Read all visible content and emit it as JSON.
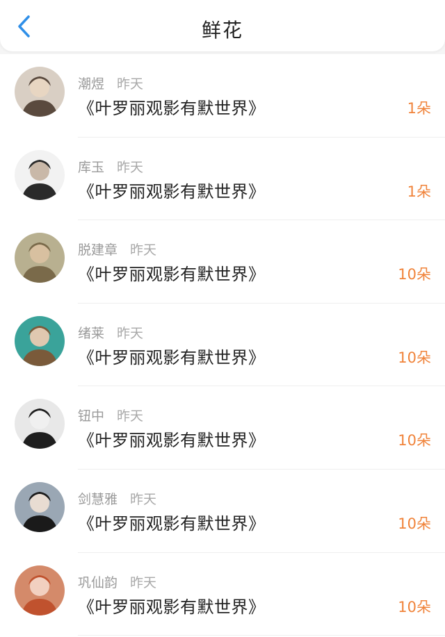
{
  "header": {
    "title": "鲜花",
    "back_icon": "chevron-left-icon",
    "accent": "#2f8fe8"
  },
  "colors": {
    "count": "#f0833a",
    "meta": "#9a9a9a"
  },
  "items": [
    {
      "name": "潮煜",
      "time": "昨天",
      "book": "《叶罗丽观影有默世界》",
      "count": "1朵",
      "avatar_palette": [
        "#d9cfc4",
        "#5a4a3e",
        "#e8d6c2"
      ]
    },
    {
      "name": "库玉",
      "time": "昨天",
      "book": "《叶罗丽观影有默世界》",
      "count": "1朵",
      "avatar_palette": [
        "#f2f2f2",
        "#2a2a2a",
        "#c9b8a8"
      ]
    },
    {
      "name": "脱建章",
      "time": "昨天",
      "book": "《叶罗丽观影有默世界》",
      "count": "10朵",
      "avatar_palette": [
        "#b8b090",
        "#7a6a4a",
        "#d8c0a0"
      ]
    },
    {
      "name": "绪莱",
      "time": "昨天",
      "book": "《叶罗丽观影有默世界》",
      "count": "10朵",
      "avatar_palette": [
        "#3aa39a",
        "#7a5a3a",
        "#e0c8b0"
      ]
    },
    {
      "name": "钮中",
      "time": "昨天",
      "book": "《叶罗丽观影有默世界》",
      "count": "10朵",
      "avatar_palette": [
        "#e8e8e8",
        "#1e1e1e",
        "#f0f0f0"
      ]
    },
    {
      "name": "剑慧雅",
      "time": "昨天",
      "book": "《叶罗丽观影有默世界》",
      "count": "10朵",
      "avatar_palette": [
        "#9aa7b4",
        "#1a1a1a",
        "#e8dcd2"
      ]
    },
    {
      "name": "巩仙韵",
      "time": "昨天",
      "book": "《叶罗丽观影有默世界》",
      "count": "10朵",
      "avatar_palette": [
        "#d48a6a",
        "#c0522e",
        "#f2d0c0"
      ]
    }
  ]
}
